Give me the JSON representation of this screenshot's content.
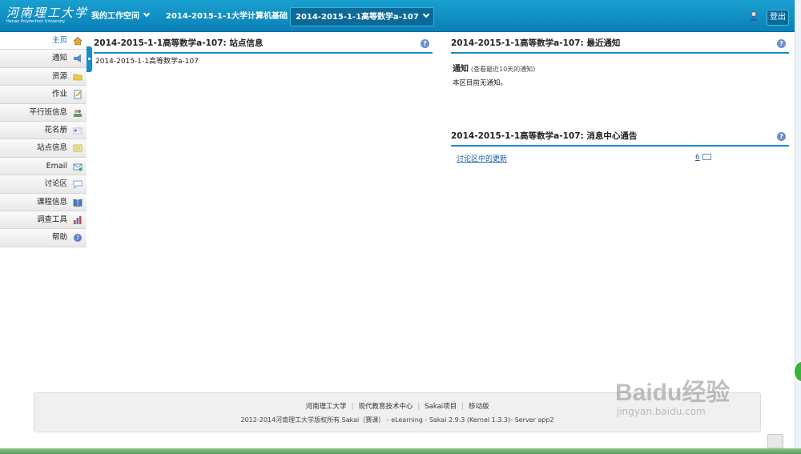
{
  "header": {
    "logo_cn": "河南理工大学",
    "logo_en": "Henan Polytechnic University",
    "tabs": [
      {
        "label": "我的工作空间"
      },
      {
        "label": "2014-2015-1-1大学计算机基础"
      },
      {
        "label": "2014-2015-1-1高等数学a-107"
      }
    ],
    "logout_label": "登出"
  },
  "sidebar": {
    "items": [
      {
        "label": "主页",
        "icon": "home-icon"
      },
      {
        "label": "通知",
        "icon": "megaphone-icon"
      },
      {
        "label": "资源",
        "icon": "folder-icon"
      },
      {
        "label": "作业",
        "icon": "assignment-icon"
      },
      {
        "label": "平行班信息",
        "icon": "group-icon"
      },
      {
        "label": "花名册",
        "icon": "roster-icon"
      },
      {
        "label": "站点信息",
        "icon": "site-info-icon"
      },
      {
        "label": "Email",
        "icon": "email-icon"
      },
      {
        "label": "讨论区",
        "icon": "discussion-icon"
      },
      {
        "label": "课程信息",
        "icon": "book-icon"
      },
      {
        "label": "调查工具",
        "icon": "chart-icon"
      },
      {
        "label": "帮助",
        "icon": "help-icon"
      }
    ]
  },
  "portlets": {
    "site_info": {
      "title": "2014-2015-1-1高等数学a-107: 站点信息",
      "body": "2014-2015-1-1高等数学a-107"
    },
    "announcements": {
      "title": "2014-2015-1-1高等数学a-107: 最近通知",
      "heading": "通知",
      "subheading": "(查看最近10天的通知)",
      "empty_text": "本区目前无通知。"
    },
    "message_center": {
      "title": "2014-2015-1-1高等数学a-107: 消息中心通告",
      "row_label": "讨论区中的更新",
      "row_count": "6"
    }
  },
  "footer": {
    "links": [
      "河南理工大学",
      "现代教育技术中心",
      "Sakai项目",
      "移动版"
    ],
    "copyright": "2012-2014河南理工大学版权所有 Sakai（赛课） - eLearning - Sakai 2.9.3 (Kernel 1.3.3)- Server app2"
  },
  "watermark": {
    "big": "Baidu经验",
    "small": "jingyan.baidu.com"
  },
  "colors": {
    "accent": "#1a8cc8",
    "topbar": "#0a80b8"
  }
}
